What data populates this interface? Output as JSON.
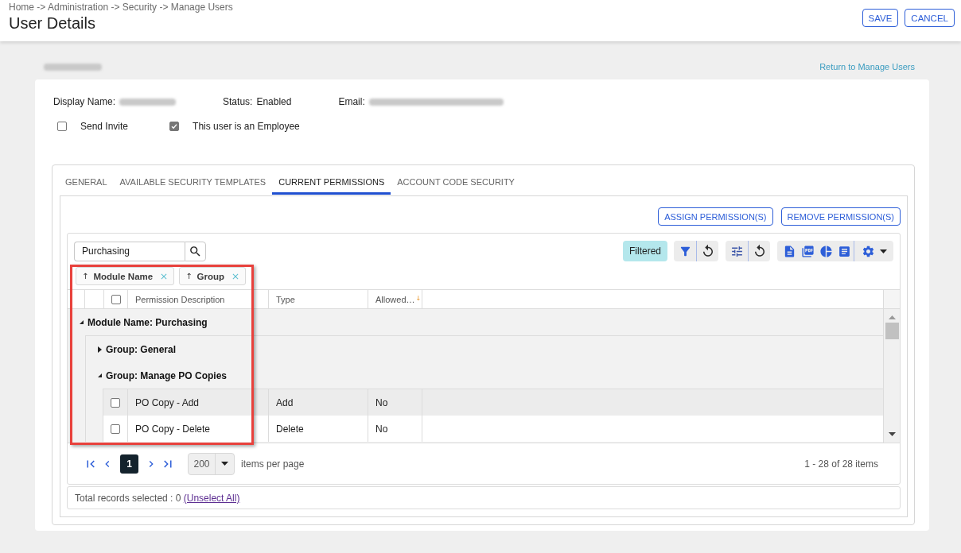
{
  "header": {
    "breadcrumb": "Home -> Administration -> Security -> Manage Users",
    "title": "User Details",
    "buttons": [
      "SAVE",
      "CANCEL"
    ]
  },
  "user_name": {
    "redacted": true
  },
  "return_link": "Return to Manage Users",
  "details": {
    "fields": [
      {
        "label": "Display Name:",
        "redacted": true
      },
      {
        "label": "Status:",
        "value": "Enabled"
      },
      {
        "label": "Email:",
        "redacted": true
      }
    ],
    "options": [
      {
        "label": "Send Invite",
        "checked": false
      },
      {
        "label": "This user is an Employee",
        "checked": true
      }
    ]
  },
  "tabs": [
    {
      "label": "GENERAL",
      "selected": false
    },
    {
      "label": "AVAILABLE SECURITY TEMPLATES",
      "selected": false
    },
    {
      "label": "CURRENT PERMISSIONS",
      "selected": true
    },
    {
      "label": "ACCOUNT CODE SECURITY",
      "selected": false
    }
  ],
  "actions": [
    "ASSIGN PERMISSION(S)",
    "REMOVE PERMISSION(S)"
  ],
  "grid": {
    "search": {
      "value": "Purchasing"
    },
    "filter_badge": "Filtered",
    "grouping": [
      {
        "arrow": "↑",
        "label": "Module Name"
      },
      {
        "arrow": "↑",
        "label": "Group"
      }
    ],
    "select_all": {
      "checked": false
    },
    "columns": [
      {
        "label": "Permission Description"
      },
      {
        "label": "Type"
      },
      {
        "label": "Allowed…",
        "sort_arrow": "↓"
      }
    ],
    "groups": [
      {
        "label": "Module Name: Purchasing",
        "expanded": true,
        "children": [
          {
            "label": "Group: General",
            "expanded": false
          },
          {
            "label": "Group: Manage PO Copies",
            "expanded": true,
            "rows": [
              {
                "checked": false,
                "highlighted": true,
                "cells": [
                  "PO Copy - Add",
                  "Add",
                  "No"
                ]
              },
              {
                "checked": false,
                "highlighted": false,
                "cells": [
                  "PO Copy - Delete",
                  "Delete",
                  "No"
                ]
              }
            ]
          }
        ]
      }
    ],
    "pager": {
      "pages": [
        {
          "label": "1",
          "selected": true
        }
      ],
      "page_size": "200",
      "page_size_label": "items per page",
      "summary": "1 - 28 of 28 items"
    },
    "footer": {
      "text": "Total records selected : 0",
      "link": "(Unselect All)"
    }
  }
}
